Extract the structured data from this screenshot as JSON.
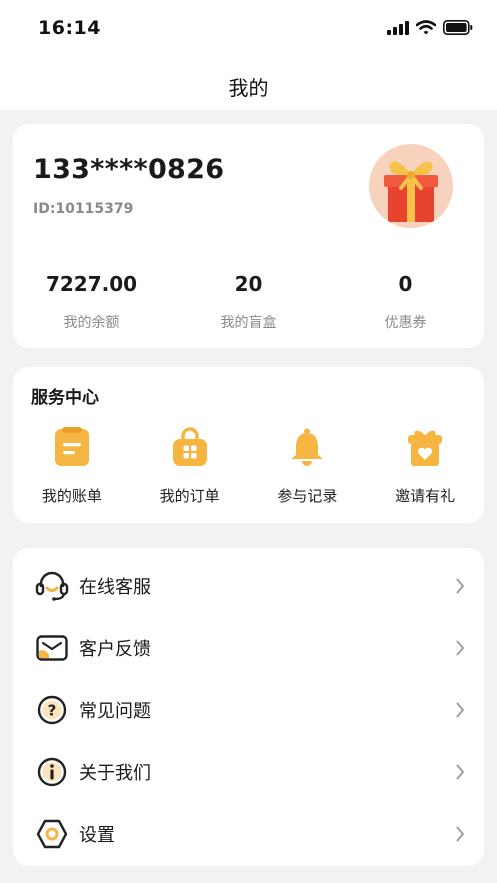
{
  "status_bar": {
    "time": "16:14"
  },
  "nav": {
    "title": "我的"
  },
  "profile": {
    "phone": "133****0826",
    "user_id": "ID:10115379",
    "stats": [
      {
        "value": "7227.00",
        "label": "我的余额"
      },
      {
        "value": "20",
        "label": "我的盲盒"
      },
      {
        "value": "0",
        "label": "优惠券"
      }
    ]
  },
  "service": {
    "title": "服务中心",
    "items": [
      {
        "label": "我的账单",
        "icon": "bill-icon"
      },
      {
        "label": "我的订单",
        "icon": "order-bag-icon"
      },
      {
        "label": "参与记录",
        "icon": "bell-icon"
      },
      {
        "label": "邀请有礼",
        "icon": "gift-heart-icon"
      }
    ]
  },
  "menu": {
    "items": [
      {
        "label": "在线客服",
        "icon": "headset-icon"
      },
      {
        "label": "客户反馈",
        "icon": "feedback-mail-icon"
      },
      {
        "label": "常见问题",
        "icon": "question-icon"
      },
      {
        "label": "关于我们",
        "icon": "info-icon"
      },
      {
        "label": "设置",
        "icon": "settings-hexagon-icon"
      }
    ]
  },
  "colors": {
    "accent": "#f5b540",
    "avatar_bg": "#f7d3bd",
    "gift_red": "#e8432e",
    "background": "#f2f2f2"
  }
}
